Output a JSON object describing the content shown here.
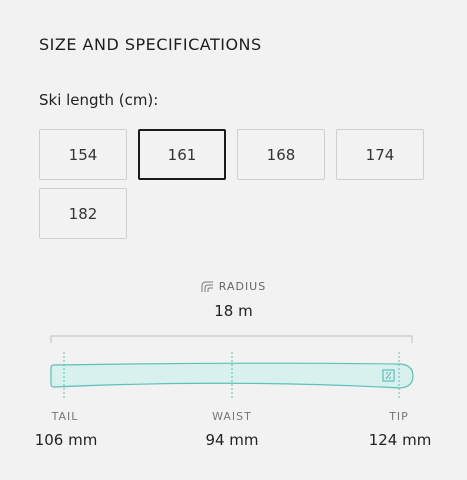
{
  "section": {
    "title": "SIZE AND SPECIFICATIONS",
    "length_label": "Ski length (cm):"
  },
  "sizes": {
    "options": [
      "154",
      "161",
      "168",
      "174",
      "182"
    ],
    "selected": "161"
  },
  "specs": {
    "radius_label": "RADIUS",
    "radius_value": "18 m",
    "tail_label": "TAIL",
    "tail_value": "106 mm",
    "waist_label": "WAIST",
    "waist_value": "94 mm",
    "tip_label": "TIP",
    "tip_value": "124 mm"
  },
  "colors": {
    "ski_fill": "#d8f0ee",
    "ski_stroke": "#5ec0b8",
    "selected_border": "#1b1b1b"
  },
  "icons": {
    "radius": "radius-icon",
    "brand": "brand-logo-icon"
  }
}
